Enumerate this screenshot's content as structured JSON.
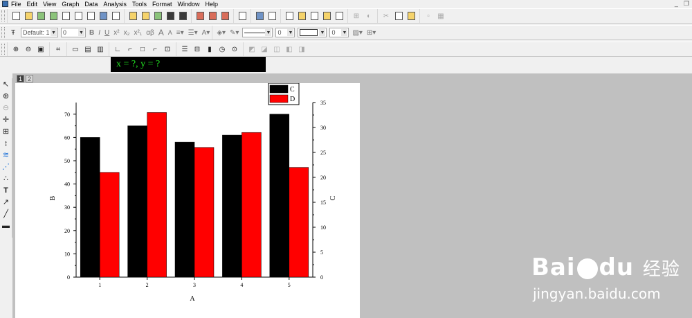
{
  "menu": [
    "File",
    "Edit",
    "View",
    "Graph",
    "Data",
    "Analysis",
    "Tools",
    "Format",
    "Window",
    "Help"
  ],
  "window_buttons": {
    "minimize": "_",
    "restore": "❐"
  },
  "format_toolbar": {
    "font": "Default: 1",
    "font_size": "0",
    "bold": "B",
    "italic": "I",
    "underline": "U",
    "superscript": "x²",
    "subscript": "x₂",
    "supsub": "x²₁",
    "greek": "αβ",
    "increase_font": "A",
    "decrease_font": "A",
    "line_width": "0",
    "pattern_width": "0"
  },
  "coordinate_readout": "x = ?, y = ?",
  "layer_tabs": [
    "1",
    "2"
  ],
  "chart_data": {
    "type": "bar",
    "categories": [
      "1",
      "2",
      "3",
      "4",
      "5"
    ],
    "xlabel": "A",
    "ylabel_left": "B",
    "ylabel_right": "C",
    "ylim_left": [
      0,
      75
    ],
    "ylim_right": [
      0,
      35
    ],
    "left_ticks": [
      "0",
      "10",
      "20",
      "30",
      "40",
      "50",
      "60",
      "70"
    ],
    "right_ticks": [
      "0",
      "5",
      "10",
      "15",
      "20",
      "25",
      "30",
      "35"
    ],
    "series": [
      {
        "name": "C",
        "axis": "left",
        "color": "#000000",
        "values": [
          60,
          65,
          58,
          61,
          70
        ]
      },
      {
        "name": "D",
        "axis": "right",
        "color": "#ff0000",
        "values": [
          21,
          33,
          26,
          29,
          22
        ]
      }
    ],
    "legend_position": "top-right"
  },
  "watermark": {
    "logo_text": "Bai",
    "logo_suffix": "du",
    "product": "经验",
    "url": "jingyan.baidu.com"
  }
}
